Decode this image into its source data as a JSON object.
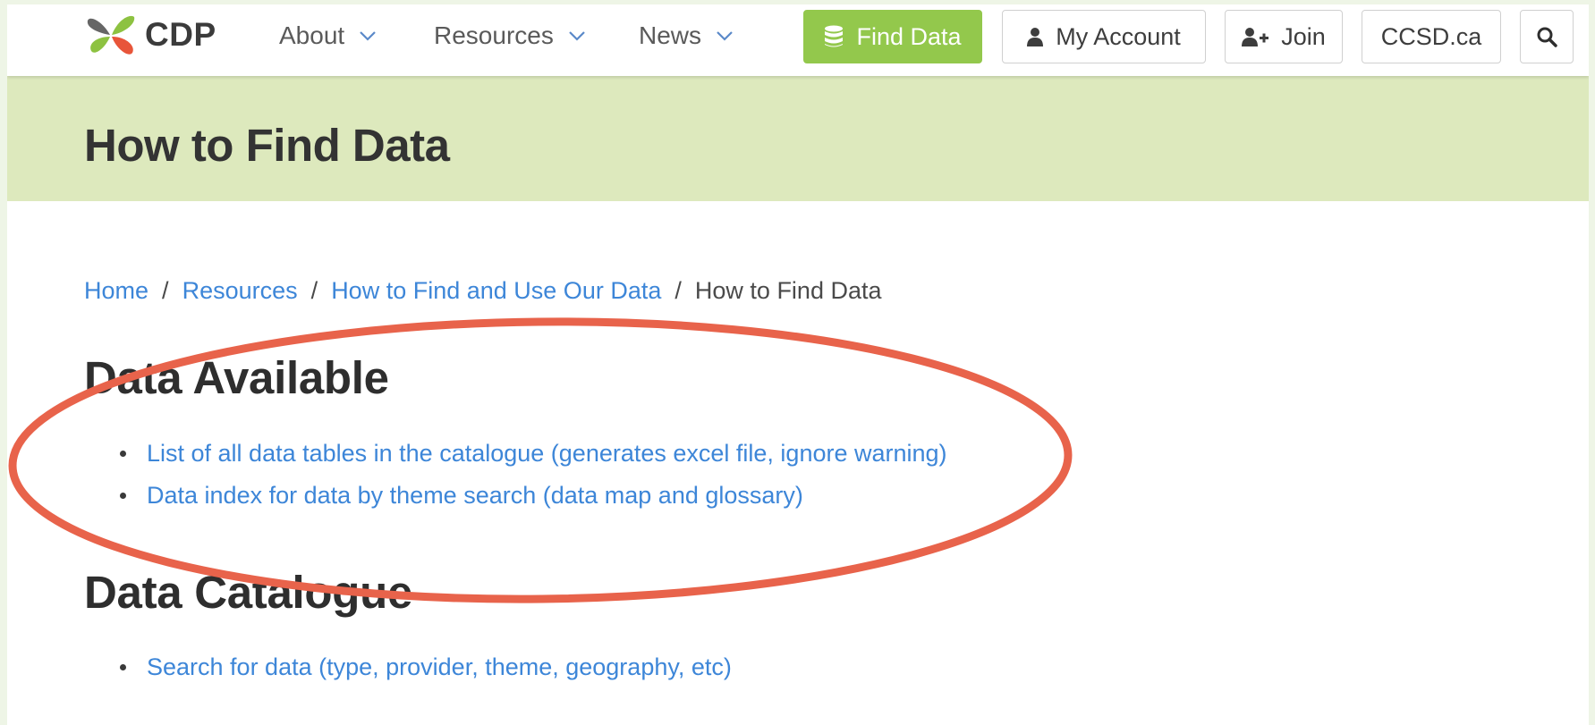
{
  "header": {
    "logo_text": "CDP",
    "nav": [
      {
        "label": "About"
      },
      {
        "label": "Resources"
      },
      {
        "label": "News"
      }
    ],
    "find_data_label": "Find Data",
    "my_account_label": "My Account",
    "join_label": "Join",
    "ccsd_label": "CCSD.ca"
  },
  "page": {
    "title": "How to Find Data"
  },
  "breadcrumb": {
    "home": "Home",
    "resources": "Resources",
    "how_to_use": "How to Find and Use Our Data",
    "current": "How to Find Data",
    "separator": "/"
  },
  "sections": {
    "available": {
      "heading": "Data Available",
      "links": [
        "List of all data tables in the catalogue (generates excel file, ignore warning)",
        "Data index for data by theme search (data map and glossary)"
      ]
    },
    "catalogue": {
      "heading": "Data Catalogue",
      "links": [
        "Search for data (type, provider, theme, geography, etc)"
      ]
    }
  },
  "colors": {
    "link": "#3d86d8",
    "find_data_button": "#93c84c",
    "title_band": "#dde9bd",
    "annotation_ellipse": "#e8634b"
  },
  "icons": {
    "logo": "butterfly-leaf-logo",
    "database": "database-icon",
    "user": "user-icon",
    "user_plus": "user-plus-icon",
    "search": "search-icon",
    "chevron": "chevron-down-icon"
  }
}
